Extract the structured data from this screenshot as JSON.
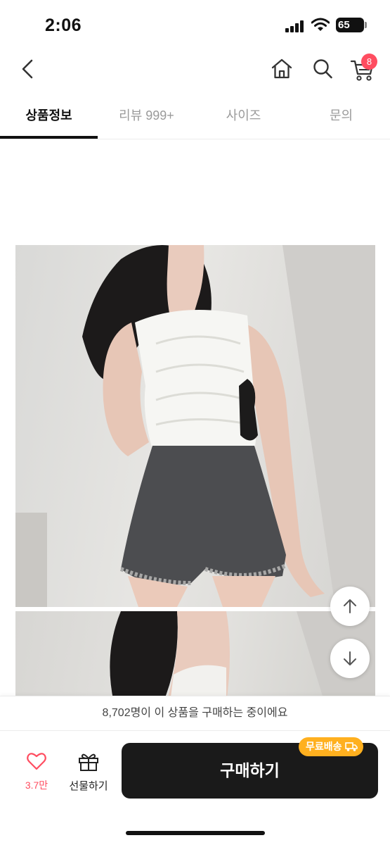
{
  "status_bar": {
    "time": "2:06",
    "battery": "65"
  },
  "header": {
    "cart_count": "8"
  },
  "tabs": [
    {
      "label": "상품정보",
      "active": true
    },
    {
      "label": "리뷰 999+",
      "active": false
    },
    {
      "label": "사이즈",
      "active": false
    },
    {
      "label": "문의",
      "active": false
    }
  ],
  "notice": "8,702명이 이 상품을 구매하는 중이에요",
  "bottom_bar": {
    "like_count": "3.7만",
    "gift_label": "선물하기",
    "buy_label": "구매하기",
    "free_shipping_badge": "무료배송"
  },
  "colors": {
    "accent_red": "#ff4d60",
    "badge_orange": "#ffb01f",
    "buy_button": "#1a1a1a"
  }
}
